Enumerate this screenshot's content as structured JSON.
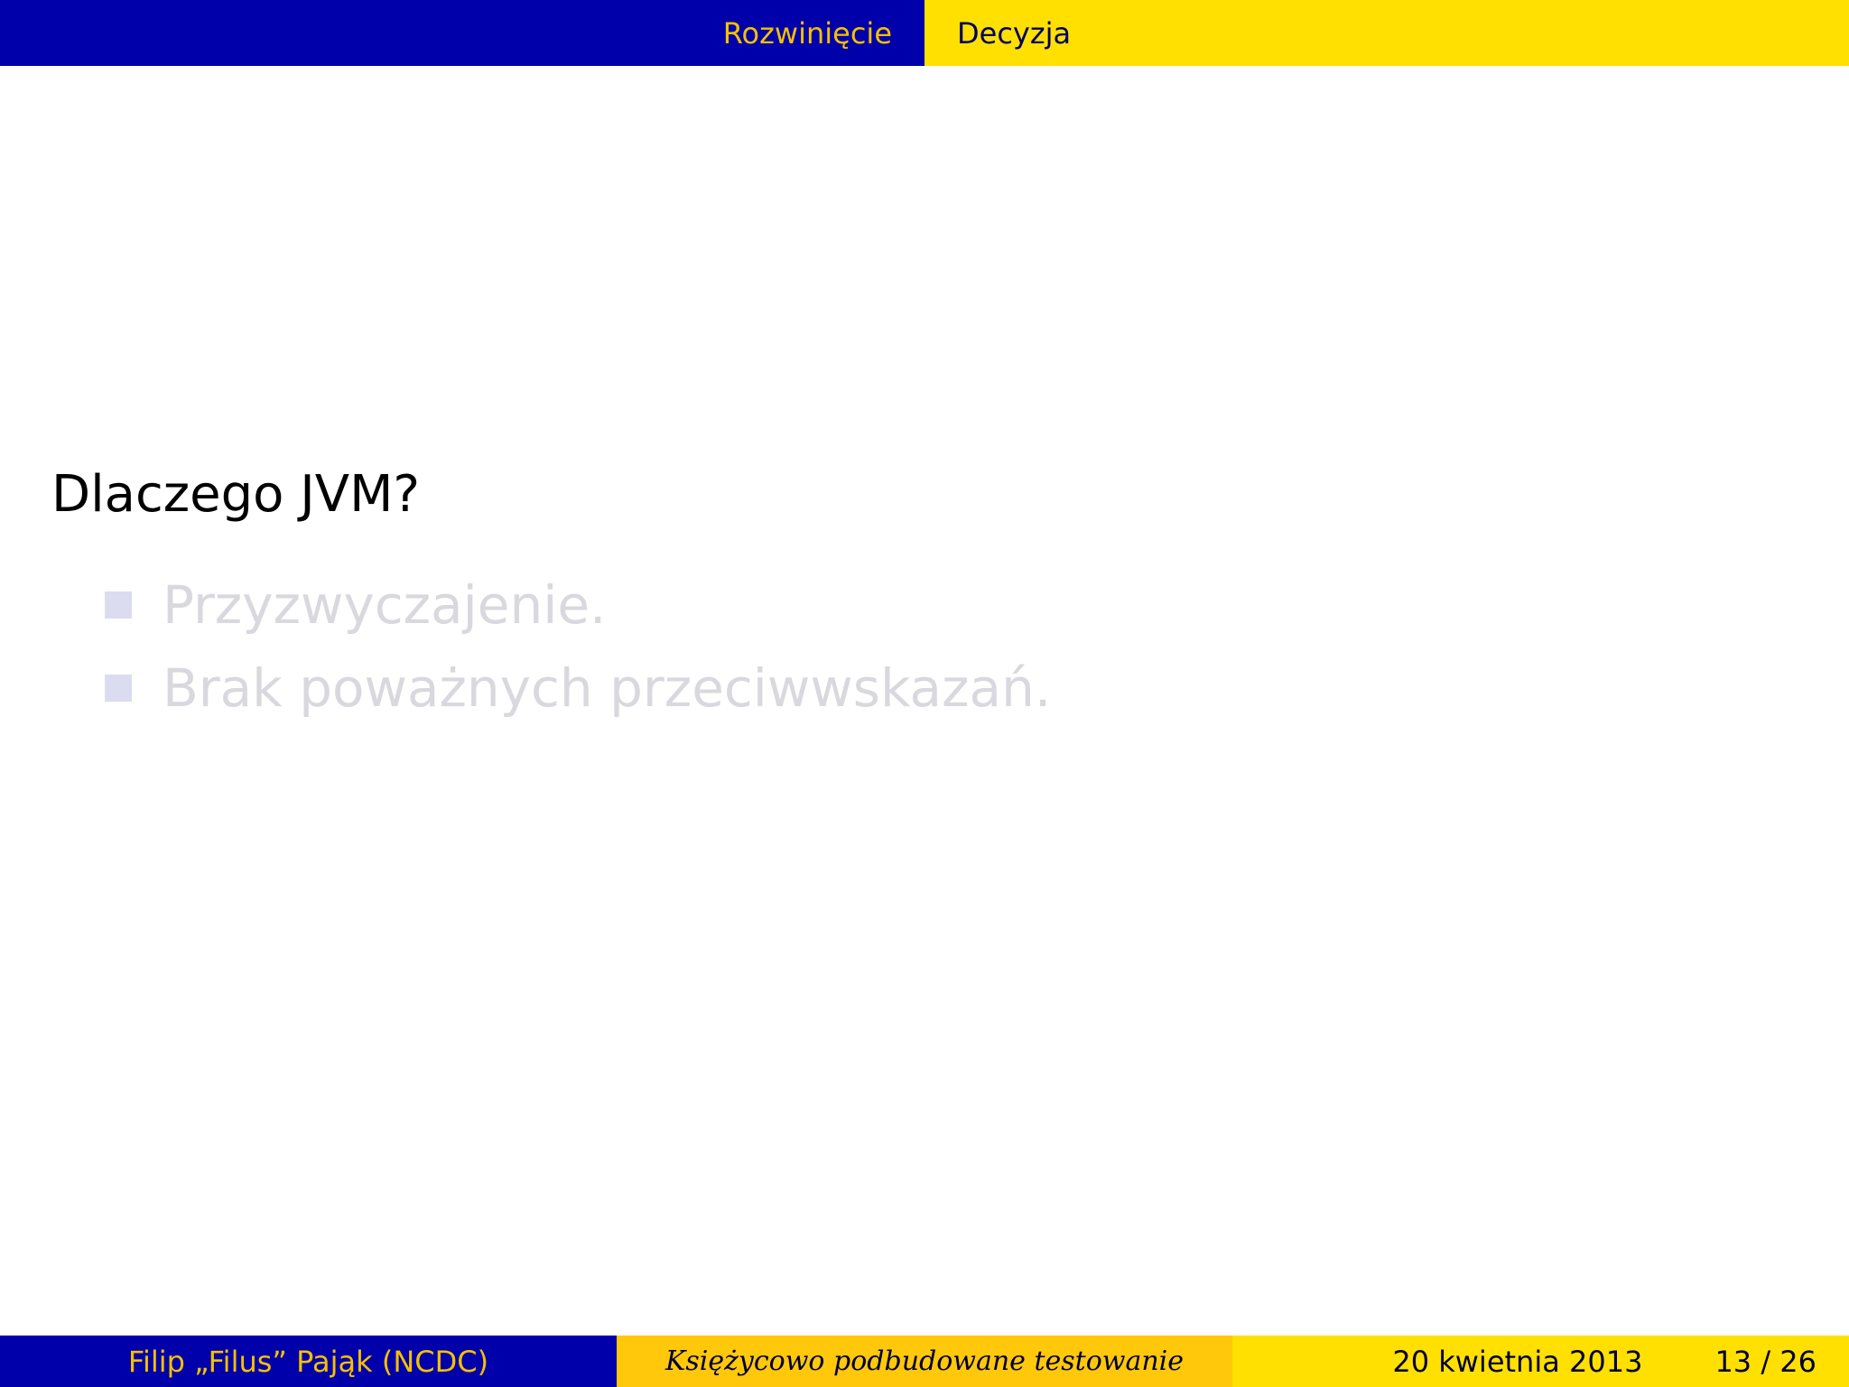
{
  "nav": {
    "sections": [
      {
        "label": "Rozwinięcie",
        "active": false
      },
      {
        "label": "Decyzja",
        "active": true
      }
    ]
  },
  "slide": {
    "title": "Dlaczego JVM?",
    "items": [
      {
        "text": "Przyzwyczajenie."
      },
      {
        "text": "Brak poważnych przeciwwskazań."
      }
    ]
  },
  "footer": {
    "author": "Filip „Filus” Pająk  (NCDC)",
    "talk_title": "Księżycowo podbudowane testowanie",
    "date": "20 kwietnia 2013",
    "page": "13 / 26"
  },
  "colors": {
    "header_dark": "#0000aa",
    "header_light": "#ffe000",
    "footer_mid": "#ffc80a",
    "inactive_text": "#f5c000",
    "dimmed_text": "#d8d8de"
  }
}
